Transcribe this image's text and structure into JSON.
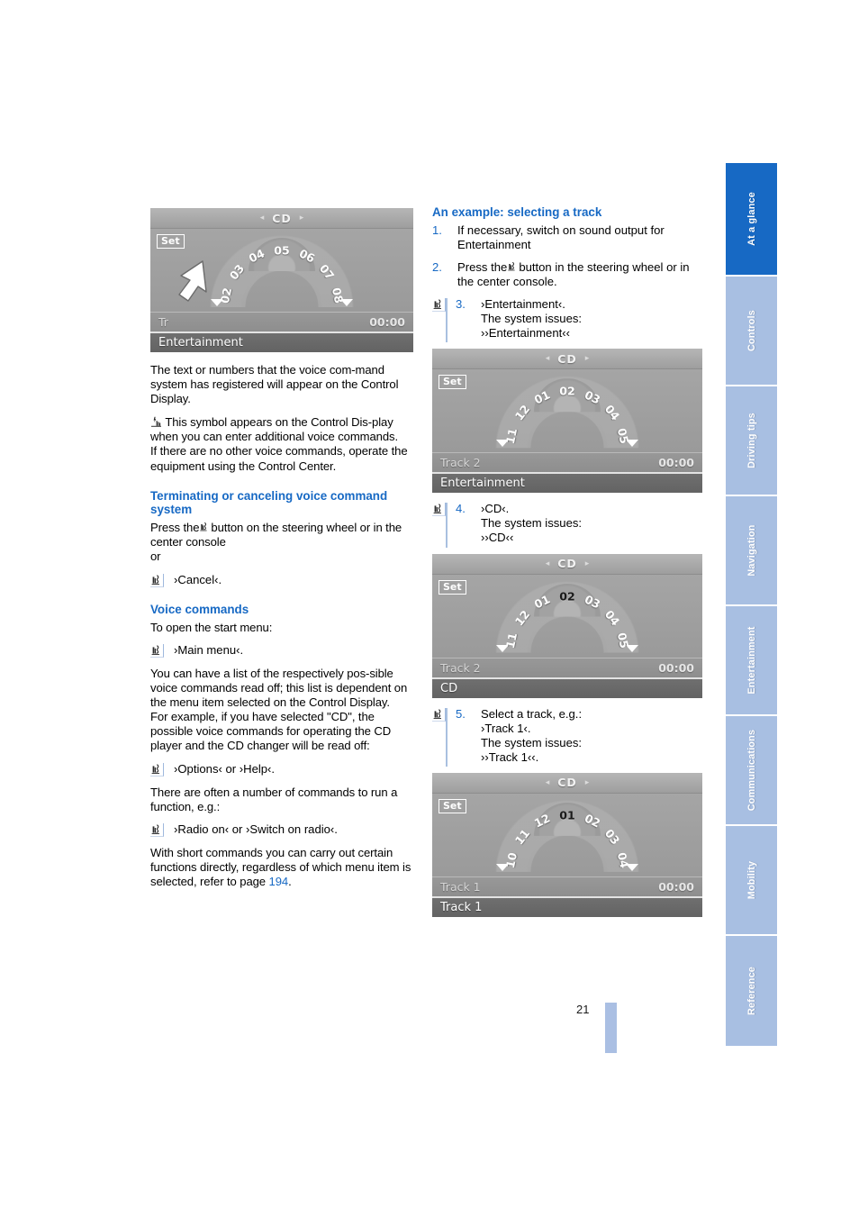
{
  "page": {
    "number": "21",
    "accent_blue": "#1769c4",
    "thumb_idle": "#a8bfe2"
  },
  "thumbs": [
    {
      "label": "At a glance",
      "active": true
    },
    {
      "label": "Controls",
      "active": false
    },
    {
      "label": "Driving tips",
      "active": false
    },
    {
      "label": "Navigation",
      "active": false
    },
    {
      "label": "Entertainment",
      "active": false
    },
    {
      "label": "Communications",
      "active": false
    },
    {
      "label": "Mobility",
      "active": false
    },
    {
      "label": "Reference",
      "active": false
    }
  ],
  "left": {
    "figure1": {
      "title": "CD",
      "set_label": "Set",
      "ticks": [
        "02",
        "03",
        "04",
        "05",
        "06",
        "07",
        "08"
      ],
      "selected": null,
      "track_label": "Tr",
      "time": "00:00",
      "bottom_label": "Entertainment",
      "has_arrow": true
    },
    "para1": "The text or numbers that the voice com-mand system has registered will appear on the Control Display.",
    "para2": "This symbol appears on the Control Dis-play when you can enter additional voice commands.",
    "para3": "If there are no other voice commands, operate the equipment using the Control Center.",
    "heading_terminating": "Terminating or canceling voice command system",
    "para4": "Press the",
    "para4b": "button on the steering wheel or in the center console",
    "para5": "or",
    "cmd_cancel": "›Cancel‹.",
    "heading_voice": "Voice commands",
    "para6": "To open the start menu:",
    "cmd_mainmenu": "›Main menu‹.",
    "para7": "You can have a list of the respectively pos-sible voice commands read off; this list is dependent on the menu item selected on the Control Display.",
    "para8": "For example, if you have selected \"CD\", the possible voice commands for operating the CD player and the CD changer will be read off:",
    "cmd_options": "›Options‹ or ›Help‹.",
    "para9": "There are often a number of commands to run a function, e.g.:",
    "cmd_radio": "›Radio on‹ or ›Switch on radio‹.",
    "para10a": "With short commands you can carry out certain functions directly, regardless of which menu item is selected, refer to page",
    "para10_page": "194",
    "para10b": "."
  },
  "right": {
    "heading": "An example: selecting a track",
    "steps": [
      {
        "num": "1.",
        "voice": false,
        "lines": [
          "If necessary, switch on sound output for Entertainment"
        ]
      },
      {
        "num": "2.",
        "voice": false,
        "lines": [
          "Press the ▮ button in the steering wheel or in the center console."
        ]
      },
      {
        "num": "3.",
        "voice": true,
        "lines": [
          "›Entertainment‹.",
          "The system issues:",
          "››Entertainment‹‹"
        ]
      },
      {
        "num": "4.",
        "voice": true,
        "lines": [
          "›CD‹.",
          "The system issues:",
          "››CD‹‹"
        ]
      },
      {
        "num": "5.",
        "voice": true,
        "lines": [
          "Select a track, e.g.:",
          "›Track 1‹.",
          "The system issues:",
          "››Track 1‹‹."
        ]
      }
    ],
    "step2_prefix": "Press the",
    "step2_suffix": "button in the steering wheel or in the center console.",
    "figure2": {
      "title": "CD",
      "set_label": "Set",
      "ticks": [
        "11",
        "12",
        "01",
        "02",
        "03",
        "04",
        "05"
      ],
      "selected": null,
      "track_label": "Track 2",
      "time": "00:00",
      "bottom_label": "Entertainment"
    },
    "figure3": {
      "title": "CD",
      "set_label": "Set",
      "ticks": [
        "11",
        "12",
        "01",
        "02",
        "03",
        "04",
        "05"
      ],
      "selected": "02",
      "track_label": "Track 2",
      "time": "00:00",
      "bottom_label": "CD"
    },
    "figure4": {
      "title": "CD",
      "set_label": "Set",
      "ticks": [
        "10",
        "11",
        "12",
        "01",
        "02",
        "03",
        "04"
      ],
      "selected": "01",
      "track_label": "Track 1",
      "time": "00:00",
      "bottom_label": "Track 1"
    }
  }
}
